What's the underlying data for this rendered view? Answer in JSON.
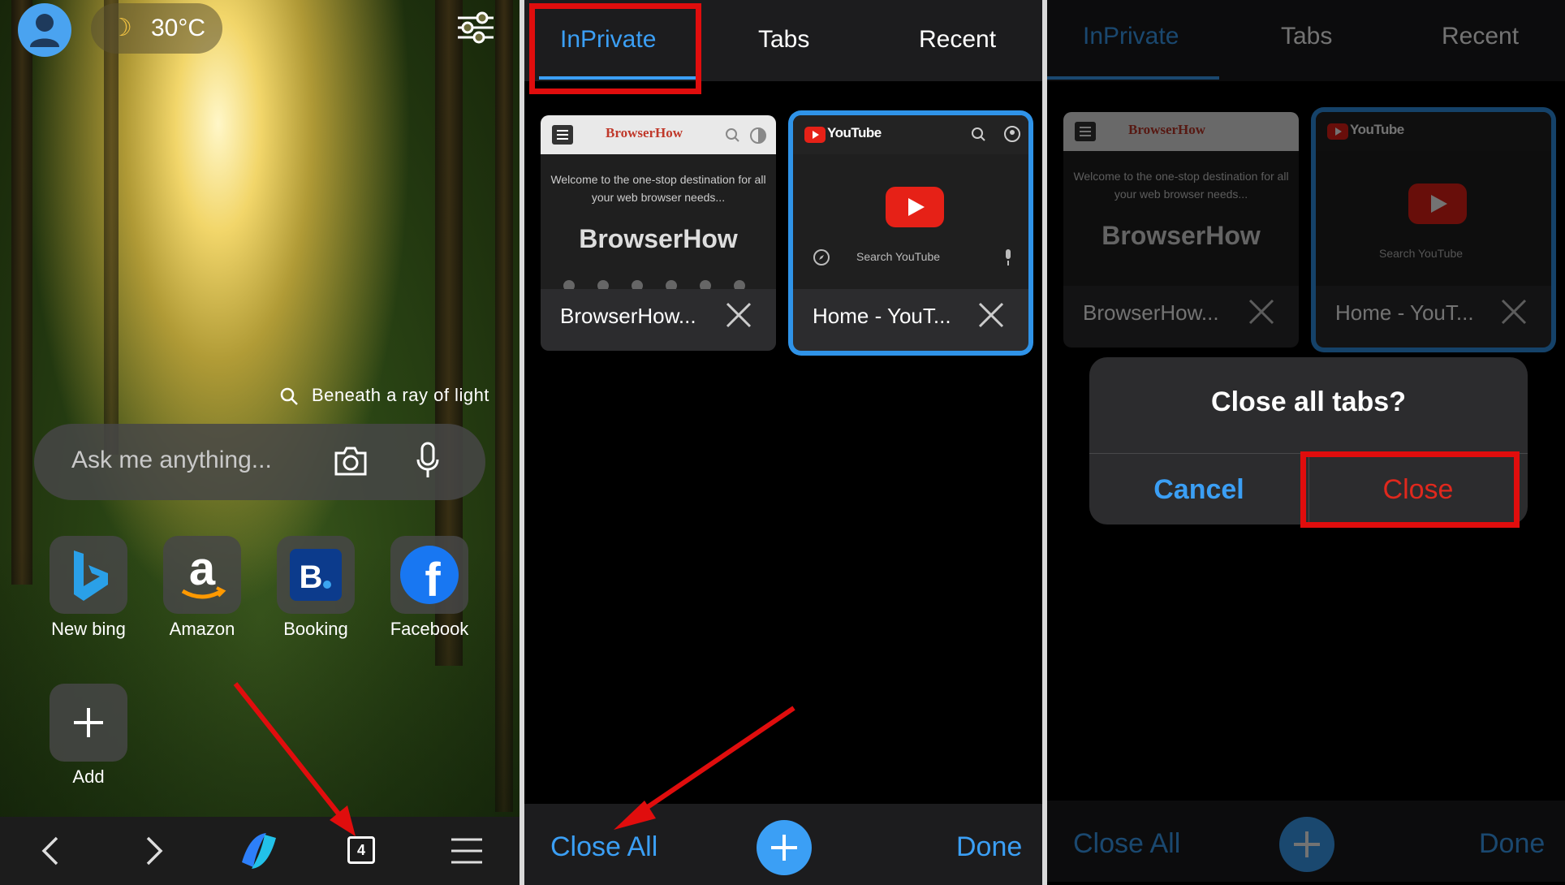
{
  "panel1": {
    "weather": {
      "icon": "moon-icon",
      "temp": "30°C"
    },
    "background_title": "Beneath a ray of light",
    "search": {
      "placeholder": "Ask me anything..."
    },
    "shortcuts": [
      {
        "label": "New bing",
        "icon": "bing-icon"
      },
      {
        "label": "Amazon",
        "icon": "amazon-icon"
      },
      {
        "label": "Booking",
        "icon": "booking-icon"
      },
      {
        "label": "Facebook",
        "icon": "facebook-icon"
      }
    ],
    "add_label": "Add",
    "tab_count": "4"
  },
  "tab_switcher": {
    "tabs": [
      "InPrivate",
      "Tabs",
      "Recent"
    ],
    "active_tab": "InPrivate",
    "cards": [
      {
        "title": "BrowserHow...",
        "site_logo": "BrowserHow",
        "description": "Welcome to the one-stop destination for all your web browser needs...",
        "heading": "BrowserHow"
      },
      {
        "title": "Home - YouT...",
        "site_logo": "YouTube",
        "search_placeholder": "Search YouTube"
      }
    ],
    "bottom": {
      "close_all": "Close All",
      "done": "Done"
    }
  },
  "dialog": {
    "title": "Close all tabs?",
    "cancel": "Cancel",
    "close": "Close"
  },
  "colors": {
    "accent": "#3b9ff5",
    "highlight": "#e00d0d",
    "youtube_red": "#e62117"
  }
}
